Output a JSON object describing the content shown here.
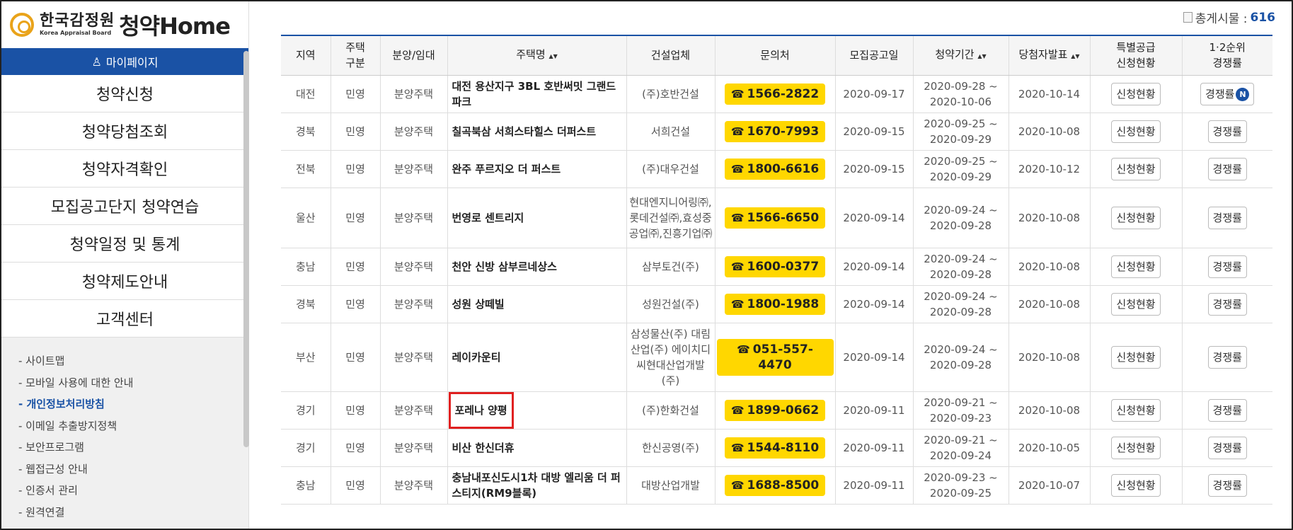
{
  "logo": {
    "kr": "한국감정원",
    "en": "Korea Appraisal Board",
    "home": "청약Home"
  },
  "sidebar": {
    "mypage": "마이페이지",
    "menu": [
      "청약신청",
      "청약당첨조회",
      "청약자격확인",
      "모집공고단지 청약연습",
      "청약일정 및 통계",
      "청약제도안내",
      "고객센터"
    ],
    "links": [
      "- 사이트맵",
      "- 모바일 사용에 대한 안내",
      "- 개인정보처리방침",
      "- 이메일 추출방지정책",
      "- 보안프로그램",
      "- 웹접근성 안내",
      "- 인증서 관리",
      "- 원격연결"
    ]
  },
  "total": {
    "label": "총게시물 : ",
    "count": "616"
  },
  "table": {
    "headers": {
      "region": "지역",
      "type1": "주택",
      "type2": "구분",
      "sale": "분양/임대",
      "name": "주택명",
      "builder": "건설업체",
      "contact": "문의처",
      "notice": "모집공고일",
      "period": "청약기간",
      "winner": "당첨자발표",
      "special1": "특별공급",
      "special2": "신청현황",
      "rank1": "1·2순위",
      "rank2": "경쟁률",
      "sort_icon": "▲▼"
    },
    "buttons": {
      "status": "신청현황",
      "rate": "경쟁률",
      "new_badge": "N"
    },
    "rows": [
      {
        "region": "대전",
        "type": "민영",
        "sale": "분양주택",
        "name": "대전 용산지구 3BL 호반써밋 그랜드파크",
        "builder": "(주)호반건설",
        "phone": "1566-2822",
        "notice": "2020-09-17",
        "period_from": "2020-09-28 ~",
        "period_to": "2020-10-06",
        "winner": "2020-10-14"
      },
      {
        "region": "경북",
        "type": "민영",
        "sale": "분양주택",
        "name": "칠곡북삼 서희스타힐스 더퍼스트",
        "builder": "서희건설",
        "phone": "1670-7993",
        "notice": "2020-09-15",
        "period_from": "2020-09-25 ~",
        "period_to": "2020-09-29",
        "winner": "2020-10-08"
      },
      {
        "region": "전북",
        "type": "민영",
        "sale": "분양주택",
        "name": "완주 푸르지오 더 퍼스트",
        "builder": "(주)대우건설",
        "phone": "1800-6616",
        "notice": "2020-09-15",
        "period_from": "2020-09-25 ~",
        "period_to": "2020-09-29",
        "winner": "2020-10-12"
      },
      {
        "region": "울산",
        "type": "민영",
        "sale": "분양주택",
        "name": "번영로 센트리지",
        "builder": "현대엔지니어링㈜,롯데건설㈜,효성중공업㈜,진흥기업㈜",
        "phone": "1566-6650",
        "notice": "2020-09-14",
        "period_from": "2020-09-24 ~",
        "period_to": "2020-09-28",
        "winner": "2020-10-08"
      },
      {
        "region": "충남",
        "type": "민영",
        "sale": "분양주택",
        "name": "천안 신방 삼부르네상스",
        "builder": "삼부토건(주)",
        "phone": "1600-0377",
        "notice": "2020-09-14",
        "period_from": "2020-09-24 ~",
        "period_to": "2020-09-28",
        "winner": "2020-10-08"
      },
      {
        "region": "경북",
        "type": "민영",
        "sale": "분양주택",
        "name": "성원 상떼빌",
        "builder": "성원건설(주)",
        "phone": "1800-1988",
        "notice": "2020-09-14",
        "period_from": "2020-09-24 ~",
        "period_to": "2020-09-28",
        "winner": "2020-10-08"
      },
      {
        "region": "부산",
        "type": "민영",
        "sale": "분양주택",
        "name": "레이카운티",
        "builder": "삼성물산(주) 대림산업(주) 에이치디씨현대산업개발(주)",
        "phone": "051-557-4470",
        "notice": "2020-09-14",
        "period_from": "2020-09-24 ~",
        "period_to": "2020-09-28",
        "winner": "2020-10-08"
      },
      {
        "region": "경기",
        "type": "민영",
        "sale": "분양주택",
        "name": "포레나 양평",
        "builder": "(주)한화건설",
        "phone": "1899-0662",
        "notice": "2020-09-11",
        "period_from": "2020-09-21 ~",
        "period_to": "2020-09-23",
        "winner": "2020-10-08"
      },
      {
        "region": "경기",
        "type": "민영",
        "sale": "분양주택",
        "name": "비산 한신더휴",
        "builder": "한신공영(주)",
        "phone": "1544-8110",
        "notice": "2020-09-11",
        "period_from": "2020-09-21 ~",
        "period_to": "2020-09-24",
        "winner": "2020-10-05"
      },
      {
        "region": "충남",
        "type": "민영",
        "sale": "분양주택",
        "name": "충남내포신도시1차 대방 엘리움 더 퍼스티지(RM9블록)",
        "builder": "대방산업개발",
        "phone": "1688-8500",
        "notice": "2020-09-11",
        "period_from": "2020-09-23 ~",
        "period_to": "2020-09-25",
        "winner": "2020-10-07"
      }
    ]
  },
  "colors": {
    "accent": "#1a52a5",
    "phone_bg": "#ffd700",
    "highlight": "#e02020"
  }
}
